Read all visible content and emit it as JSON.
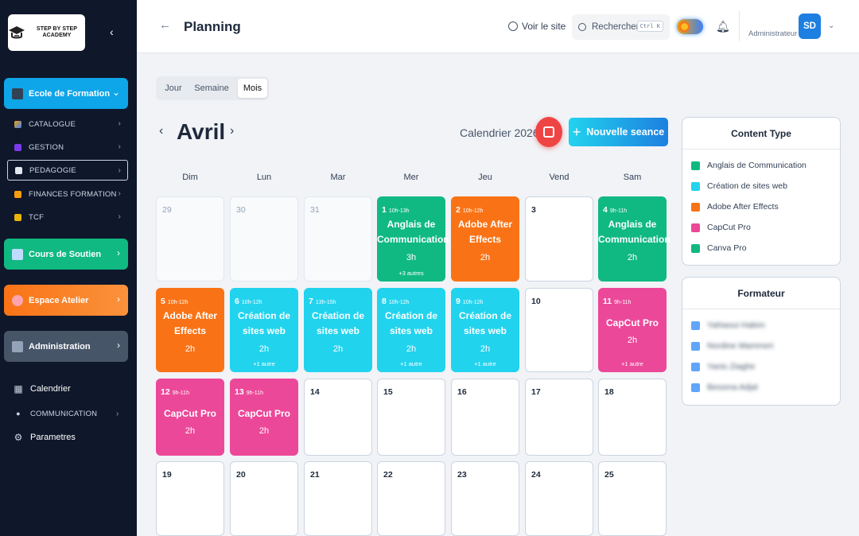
{
  "sidebar": {
    "logo_text": "STEP BY STEP ACADEMY",
    "blocks": [
      {
        "label": "Ecole de Formation",
        "color": "#0ea5e9",
        "chev": "⌄"
      },
      {
        "label": "Cours de Soutien",
        "color": "#10b981",
        "chev": "›"
      },
      {
        "label": "Espace Atelier",
        "color": "#f97316",
        "chev": "›"
      },
      {
        "label": "Administration",
        "color": "#475569",
        "chev": "›"
      }
    ],
    "subitems": [
      "CATALOGUE",
      "GESTION",
      "PEDAGOGIE",
      "FINANCES FORMATION",
      "TCF"
    ],
    "bottom": [
      {
        "label": "Calendrier",
        "icon": "calendar-icon"
      },
      {
        "label": "COMMUNICATION",
        "icon": "chat-icon"
      },
      {
        "label": "Parametres",
        "icon": "gear-icon"
      }
    ]
  },
  "header": {
    "title": "Planning",
    "voir_site": "Voir le site",
    "search_placeholder": "Rechercher...",
    "search_kbd": "Ctrl K",
    "role": "Administrateur",
    "avatar": "SD"
  },
  "view_tabs": [
    "Jour",
    "Semaine",
    "Mois"
  ],
  "active_view": "Mois",
  "calendar": {
    "month": "Avril",
    "year_label": "Calendrier 2026",
    "new_button": "Nouvelle seance",
    "weekdays": [
      "Dim",
      "Lun",
      "Mar",
      "Mer",
      "Jeu",
      "Vend",
      "Sam"
    ],
    "weeks": [
      [
        {
          "day": "29",
          "muted": true
        },
        {
          "day": "30",
          "muted": true
        },
        {
          "day": "31",
          "muted": true
        },
        {
          "day": "1",
          "time": "10h-13h",
          "title": "Anglais de Communication",
          "duration": "3h",
          "more": "+3 autres",
          "color": "green"
        },
        {
          "day": "2",
          "time": "10h-12h",
          "title": "Adobe After Effects",
          "duration": "2h",
          "color": "orange"
        },
        {
          "day": "3"
        },
        {
          "day": "4",
          "time": "9h-11h",
          "title": "Anglais de Communication",
          "duration": "2h",
          "color": "green"
        }
      ],
      [
        {
          "day": "5",
          "time": "10h-12h",
          "title": "Adobe After Effects",
          "duration": "2h",
          "color": "orange"
        },
        {
          "day": "6",
          "time": "10h-12h",
          "title": "Création de sites web",
          "duration": "2h",
          "more": "+1 autre",
          "color": "cyan"
        },
        {
          "day": "7",
          "time": "13h-15h",
          "title": "Création de sites web",
          "duration": "2h",
          "color": "cyan"
        },
        {
          "day": "8",
          "time": "10h-12h",
          "title": "Création de sites web",
          "duration": "2h",
          "more": "+1 autre",
          "color": "cyan"
        },
        {
          "day": "9",
          "time": "10h-12h",
          "title": "Création de sites web",
          "duration": "2h",
          "more": "+1 autre",
          "color": "cyan"
        },
        {
          "day": "10"
        },
        {
          "day": "11",
          "time": "9h-11h",
          "title": "CapCut Pro",
          "duration": "2h",
          "more": "+1 autre",
          "color": "pink"
        }
      ],
      [
        {
          "day": "12",
          "time": "9h-11h",
          "title": "CapCut Pro",
          "duration": "2h",
          "color": "pink"
        },
        {
          "day": "13",
          "time": "9h-11h",
          "title": "CapCut Pro",
          "duration": "2h",
          "color": "pink"
        },
        {
          "day": "14"
        },
        {
          "day": "15"
        },
        {
          "day": "16"
        },
        {
          "day": "17"
        },
        {
          "day": "18"
        }
      ],
      [
        {
          "day": "19"
        },
        {
          "day": "20"
        },
        {
          "day": "21"
        },
        {
          "day": "22"
        },
        {
          "day": "23"
        },
        {
          "day": "24"
        },
        {
          "day": "25"
        }
      ]
    ]
  },
  "content_type": {
    "title": "Content Type",
    "items": [
      {
        "label": "Anglais de Communication",
        "color": "#10b981"
      },
      {
        "label": "Création de sites web",
        "color": "#22d3ee"
      },
      {
        "label": "Adobe After Effects",
        "color": "#f97316"
      },
      {
        "label": "CapCut Pro",
        "color": "#ec4899"
      },
      {
        "label": "Canva Pro",
        "color": "#10b981"
      }
    ]
  },
  "formateur": {
    "title": "Formateur",
    "items": [
      {
        "label": "Yahiaoui Hakim",
        "color": "#60a5fa"
      },
      {
        "label": "Nordine Mammeri",
        "color": "#60a5fa"
      },
      {
        "label": "Yanis Ziaghe",
        "color": "#60a5fa"
      },
      {
        "label": "Bessma Adjal",
        "color": "#60a5fa"
      }
    ]
  },
  "colors": {
    "green": "#10b981",
    "orange": "#f97316",
    "cyan": "#22d3ee",
    "pink": "#ec4899",
    "sidebar": "#0f172a"
  }
}
